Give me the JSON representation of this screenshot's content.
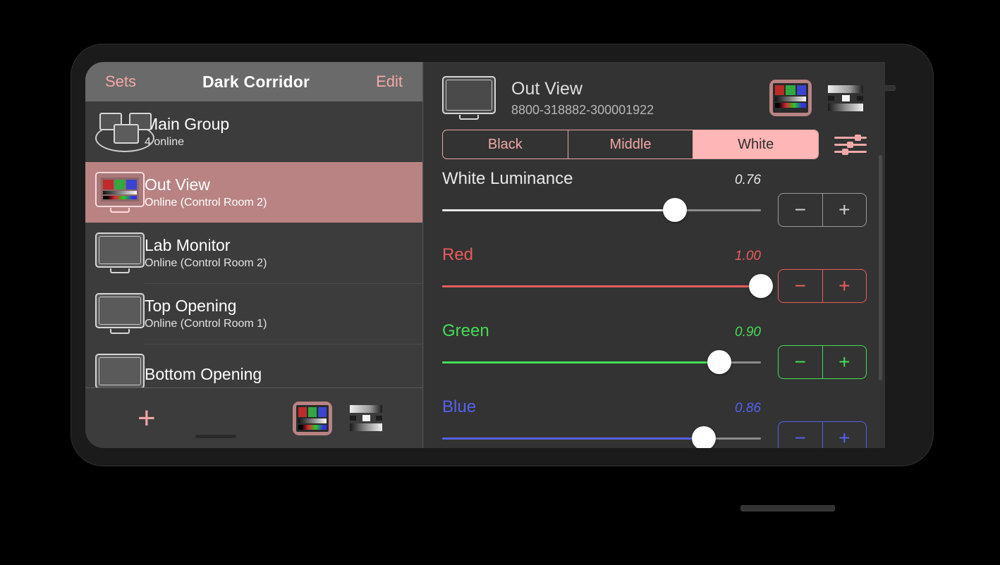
{
  "sidebar": {
    "nav": {
      "back_label": "Sets",
      "title": "Dark Corridor",
      "edit_label": "Edit"
    },
    "items": [
      {
        "title": "Main Group",
        "subtitle": "4 online",
        "icon": "monitor-group-icon",
        "selected": false
      },
      {
        "title": "Out View",
        "subtitle": "Online (Control Room 2)",
        "icon": "monitor-colorbars-icon",
        "selected": true
      },
      {
        "title": "Lab Monitor",
        "subtitle": "Online (Control Room 2)",
        "icon": "monitor-icon",
        "selected": false
      },
      {
        "title": "Top Opening",
        "subtitle": "Online (Control Room 1)",
        "icon": "monitor-icon",
        "selected": false
      },
      {
        "title": "Bottom Opening",
        "subtitle": "",
        "icon": "monitor-icon",
        "selected": false
      }
    ],
    "toolbar": {
      "add_label": "+",
      "patterns": [
        {
          "name": "color-bars-pattern",
          "selected": true
        },
        {
          "name": "greyscale-pattern",
          "selected": false
        }
      ]
    }
  },
  "detail": {
    "device": {
      "name": "Out View",
      "serial": "8800-318882-300001922",
      "patterns": [
        {
          "name": "color-bars-pattern",
          "selected": true
        },
        {
          "name": "greyscale-pattern",
          "selected": false
        }
      ]
    },
    "segments": [
      {
        "label": "Black",
        "selected": false
      },
      {
        "label": "Middle",
        "selected": false
      },
      {
        "label": "White",
        "selected": true
      }
    ],
    "sliders": [
      {
        "label": "White Luminance",
        "value": "0.76",
        "fraction": 0.76,
        "color": "#e8e8e8",
        "accent": "#cfcfcf",
        "minus": "−",
        "plus": "+"
      },
      {
        "label": "Red",
        "value": "1.00",
        "fraction": 1.0,
        "color": "#e85c5c",
        "accent": "#e85c5c",
        "minus": "−",
        "plus": "+"
      },
      {
        "label": "Green",
        "value": "0.90",
        "fraction": 0.9,
        "color": "#44dd55",
        "accent": "#44dd55",
        "minus": "−",
        "plus": "+"
      },
      {
        "label": "Blue",
        "value": "0.86",
        "fraction": 0.86,
        "color": "#5560ee",
        "accent": "#5560ee",
        "minus": "−",
        "plus": "+"
      }
    ]
  },
  "colors": {
    "accent_pink": "#f0a8a8",
    "selected_row": "#b98383",
    "segment_active": "#ffb6b6"
  }
}
